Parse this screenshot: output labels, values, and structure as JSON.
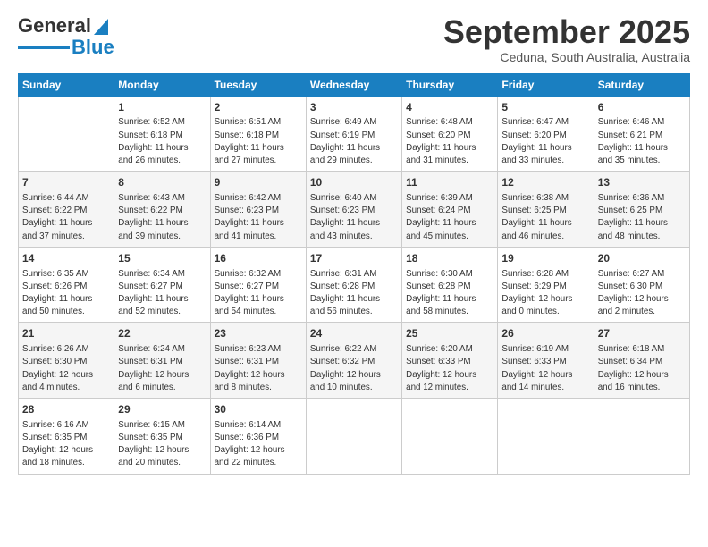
{
  "logo": {
    "text_general": "General",
    "text_blue": "Blue"
  },
  "header": {
    "month": "September 2025",
    "location": "Ceduna, South Australia, Australia"
  },
  "days_of_week": [
    "Sunday",
    "Monday",
    "Tuesday",
    "Wednesday",
    "Thursday",
    "Friday",
    "Saturday"
  ],
  "weeks": [
    [
      {
        "day": "",
        "sunrise": "",
        "sunset": "",
        "daylight": ""
      },
      {
        "day": "1",
        "sunrise": "Sunrise: 6:52 AM",
        "sunset": "Sunset: 6:18 PM",
        "daylight": "Daylight: 11 hours and 26 minutes."
      },
      {
        "day": "2",
        "sunrise": "Sunrise: 6:51 AM",
        "sunset": "Sunset: 6:18 PM",
        "daylight": "Daylight: 11 hours and 27 minutes."
      },
      {
        "day": "3",
        "sunrise": "Sunrise: 6:49 AM",
        "sunset": "Sunset: 6:19 PM",
        "daylight": "Daylight: 11 hours and 29 minutes."
      },
      {
        "day": "4",
        "sunrise": "Sunrise: 6:48 AM",
        "sunset": "Sunset: 6:20 PM",
        "daylight": "Daylight: 11 hours and 31 minutes."
      },
      {
        "day": "5",
        "sunrise": "Sunrise: 6:47 AM",
        "sunset": "Sunset: 6:20 PM",
        "daylight": "Daylight: 11 hours and 33 minutes."
      },
      {
        "day": "6",
        "sunrise": "Sunrise: 6:46 AM",
        "sunset": "Sunset: 6:21 PM",
        "daylight": "Daylight: 11 hours and 35 minutes."
      }
    ],
    [
      {
        "day": "7",
        "sunrise": "Sunrise: 6:44 AM",
        "sunset": "Sunset: 6:22 PM",
        "daylight": "Daylight: 11 hours and 37 minutes."
      },
      {
        "day": "8",
        "sunrise": "Sunrise: 6:43 AM",
        "sunset": "Sunset: 6:22 PM",
        "daylight": "Daylight: 11 hours and 39 minutes."
      },
      {
        "day": "9",
        "sunrise": "Sunrise: 6:42 AM",
        "sunset": "Sunset: 6:23 PM",
        "daylight": "Daylight: 11 hours and 41 minutes."
      },
      {
        "day": "10",
        "sunrise": "Sunrise: 6:40 AM",
        "sunset": "Sunset: 6:23 PM",
        "daylight": "Daylight: 11 hours and 43 minutes."
      },
      {
        "day": "11",
        "sunrise": "Sunrise: 6:39 AM",
        "sunset": "Sunset: 6:24 PM",
        "daylight": "Daylight: 11 hours and 45 minutes."
      },
      {
        "day": "12",
        "sunrise": "Sunrise: 6:38 AM",
        "sunset": "Sunset: 6:25 PM",
        "daylight": "Daylight: 11 hours and 46 minutes."
      },
      {
        "day": "13",
        "sunrise": "Sunrise: 6:36 AM",
        "sunset": "Sunset: 6:25 PM",
        "daylight": "Daylight: 11 hours and 48 minutes."
      }
    ],
    [
      {
        "day": "14",
        "sunrise": "Sunrise: 6:35 AM",
        "sunset": "Sunset: 6:26 PM",
        "daylight": "Daylight: 11 hours and 50 minutes."
      },
      {
        "day": "15",
        "sunrise": "Sunrise: 6:34 AM",
        "sunset": "Sunset: 6:27 PM",
        "daylight": "Daylight: 11 hours and 52 minutes."
      },
      {
        "day": "16",
        "sunrise": "Sunrise: 6:32 AM",
        "sunset": "Sunset: 6:27 PM",
        "daylight": "Daylight: 11 hours and 54 minutes."
      },
      {
        "day": "17",
        "sunrise": "Sunrise: 6:31 AM",
        "sunset": "Sunset: 6:28 PM",
        "daylight": "Daylight: 11 hours and 56 minutes."
      },
      {
        "day": "18",
        "sunrise": "Sunrise: 6:30 AM",
        "sunset": "Sunset: 6:28 PM",
        "daylight": "Daylight: 11 hours and 58 minutes."
      },
      {
        "day": "19",
        "sunrise": "Sunrise: 6:28 AM",
        "sunset": "Sunset: 6:29 PM",
        "daylight": "Daylight: 12 hours and 0 minutes."
      },
      {
        "day": "20",
        "sunrise": "Sunrise: 6:27 AM",
        "sunset": "Sunset: 6:30 PM",
        "daylight": "Daylight: 12 hours and 2 minutes."
      }
    ],
    [
      {
        "day": "21",
        "sunrise": "Sunrise: 6:26 AM",
        "sunset": "Sunset: 6:30 PM",
        "daylight": "Daylight: 12 hours and 4 minutes."
      },
      {
        "day": "22",
        "sunrise": "Sunrise: 6:24 AM",
        "sunset": "Sunset: 6:31 PM",
        "daylight": "Daylight: 12 hours and 6 minutes."
      },
      {
        "day": "23",
        "sunrise": "Sunrise: 6:23 AM",
        "sunset": "Sunset: 6:31 PM",
        "daylight": "Daylight: 12 hours and 8 minutes."
      },
      {
        "day": "24",
        "sunrise": "Sunrise: 6:22 AM",
        "sunset": "Sunset: 6:32 PM",
        "daylight": "Daylight: 12 hours and 10 minutes."
      },
      {
        "day": "25",
        "sunrise": "Sunrise: 6:20 AM",
        "sunset": "Sunset: 6:33 PM",
        "daylight": "Daylight: 12 hours and 12 minutes."
      },
      {
        "day": "26",
        "sunrise": "Sunrise: 6:19 AM",
        "sunset": "Sunset: 6:33 PM",
        "daylight": "Daylight: 12 hours and 14 minutes."
      },
      {
        "day": "27",
        "sunrise": "Sunrise: 6:18 AM",
        "sunset": "Sunset: 6:34 PM",
        "daylight": "Daylight: 12 hours and 16 minutes."
      }
    ],
    [
      {
        "day": "28",
        "sunrise": "Sunrise: 6:16 AM",
        "sunset": "Sunset: 6:35 PM",
        "daylight": "Daylight: 12 hours and 18 minutes."
      },
      {
        "day": "29",
        "sunrise": "Sunrise: 6:15 AM",
        "sunset": "Sunset: 6:35 PM",
        "daylight": "Daylight: 12 hours and 20 minutes."
      },
      {
        "day": "30",
        "sunrise": "Sunrise: 6:14 AM",
        "sunset": "Sunset: 6:36 PM",
        "daylight": "Daylight: 12 hours and 22 minutes."
      },
      {
        "day": "",
        "sunrise": "",
        "sunset": "",
        "daylight": ""
      },
      {
        "day": "",
        "sunrise": "",
        "sunset": "",
        "daylight": ""
      },
      {
        "day": "",
        "sunrise": "",
        "sunset": "",
        "daylight": ""
      },
      {
        "day": "",
        "sunrise": "",
        "sunset": "",
        "daylight": ""
      }
    ]
  ]
}
